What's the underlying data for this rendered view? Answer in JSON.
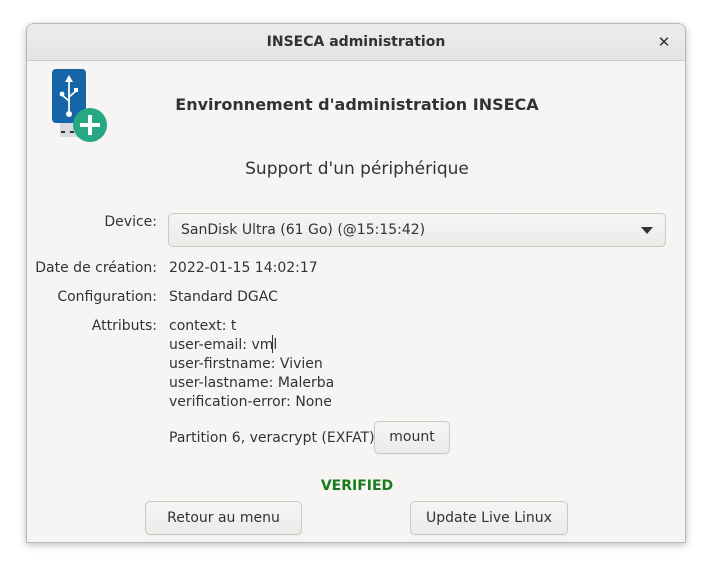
{
  "window": {
    "title": "INSECA administration"
  },
  "header": {
    "title": "Environnement d'administration INSECA",
    "subtitle": "Support d'un périphérique"
  },
  "form": {
    "device_label": "Device:",
    "device_value": "SanDisk Ultra (61 Go) (@15:15:42)",
    "creation_label": "Date de création:",
    "creation_value": "2022-01-15 14:02:17",
    "configuration_label": "Configuration:",
    "configuration_value": "Standard DGAC",
    "attributes_label": "Attributs:",
    "attributes": [
      "context: t",
      "user-email: vml",
      "user-firstname: Vivien",
      "user-lastname: Malerba",
      "verification-error: None"
    ],
    "partition_text": "Partition 6, veracrypt (EXFAT)",
    "mount_label": "mount"
  },
  "status": {
    "text": "VERIFIED",
    "color": "#1a7a1a"
  },
  "buttons": {
    "back_label": "Retour au menu",
    "update_label": "Update Live Linux"
  },
  "icons": {
    "logo": "usb-drive-add-icon",
    "close": "close-icon"
  },
  "colors": {
    "usb_blue": "#1565a8",
    "plus_green": "#26a883"
  }
}
